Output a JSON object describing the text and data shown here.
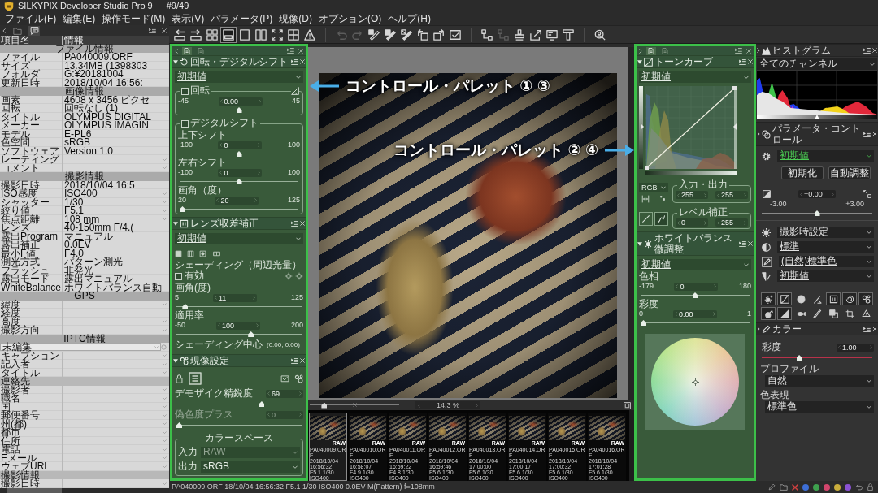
{
  "window": {
    "title": "SILKYPIX Developer Studio Pro 9",
    "counter": "#9/49"
  },
  "menu": [
    "ファイル(F)",
    "編集(E)",
    "操作モード(M)",
    "表示(V)",
    "パラメータ(P)",
    "現像(D)",
    "オプション(O)",
    "ヘルプ(H)"
  ],
  "toolbar": [
    [
      {
        "selected": false,
        "disabled": false
      },
      {
        "selected": false,
        "disabled": false
      },
      {
        "selected": false,
        "disabled": false
      },
      {
        "selected": true,
        "disabled": false
      },
      {
        "selected": false,
        "disabled": false
      },
      {
        "selected": false,
        "disabled": false
      },
      {
        "selected": false,
        "disabled": false
      },
      {
        "selected": false,
        "disabled": false
      },
      {
        "selected": false,
        "disabled": false
      }
    ],
    [
      {
        "selected": false,
        "disabled": true
      },
      {
        "selected": false,
        "disabled": true
      },
      {
        "selected": false,
        "disabled": false
      },
      {
        "selected": false,
        "disabled": false
      },
      {
        "selected": false,
        "disabled": false
      },
      {
        "selected": false,
        "disabled": false
      },
      {
        "selected": false,
        "disabled": false
      },
      {
        "selected": false,
        "disabled": false
      }
    ],
    [
      {
        "selected": false,
        "disabled": false
      },
      {
        "selected": false,
        "disabled": true
      },
      {
        "selected": false,
        "disabled": false
      },
      {
        "selected": false,
        "disabled": false
      },
      {
        "selected": false,
        "disabled": false
      },
      {
        "selected": false,
        "disabled": false
      }
    ],
    [
      {
        "selected": false,
        "disabled": false
      }
    ]
  ],
  "info_panel": {
    "tabs": [
      {
        "selected": false
      },
      {
        "selected": true
      }
    ],
    "columns": [
      "項目名",
      "情報"
    ],
    "rows": [
      {
        "kind": "section",
        "label": "ファイル情報"
      },
      {
        "kind": "field",
        "label": "ファイル",
        "value": "PA040009.ORF",
        "editable": false
      },
      {
        "kind": "field",
        "label": "サイズ",
        "value": "13.34MB (1398303",
        "editable": false
      },
      {
        "kind": "field",
        "label": "フォルダ",
        "value": "G:¥20181004",
        "editable": false
      },
      {
        "kind": "field",
        "label": "更新日時",
        "value": "2018/10/04 16:56:",
        "editable": false
      },
      {
        "kind": "section",
        "label": "画像情報"
      },
      {
        "kind": "field",
        "label": "画素",
        "value": "4608 x 3456 ピクセ",
        "editable": false
      },
      {
        "kind": "field",
        "label": "回転",
        "value": "回転なし (1)",
        "editable": false
      },
      {
        "kind": "field",
        "label": "タイトル",
        "value": "OLYMPUS DIGITAL",
        "editable": false
      },
      {
        "kind": "field",
        "label": "メーカー",
        "value": "OLYMPUS IMAGIN",
        "editable": false
      },
      {
        "kind": "field",
        "label": "モデル",
        "value": "E-PL6",
        "editable": false
      },
      {
        "kind": "field",
        "label": "色空間",
        "value": "sRGB",
        "editable": false
      },
      {
        "kind": "field",
        "label": "ソフトウェア",
        "value": "Version 1.0",
        "editable": false
      },
      {
        "kind": "field",
        "label": "レーティング",
        "editable": true
      },
      {
        "kind": "field",
        "label": "コメント",
        "editable": true
      },
      {
        "kind": "section",
        "label": "撮影情報"
      },
      {
        "kind": "field",
        "label": "撮影日時",
        "value": "2018/10/04 16:5",
        "editable": false
      },
      {
        "kind": "field",
        "label": "ISO感度",
        "value": "ISO400",
        "editable": true
      },
      {
        "kind": "field",
        "label": "シャッター",
        "value": "1/30",
        "editable": true
      },
      {
        "kind": "field",
        "label": "絞り値",
        "value": "F5.1",
        "editable": true
      },
      {
        "kind": "field",
        "label": "焦点距離",
        "value": "108 mm",
        "editable": true
      },
      {
        "kind": "field",
        "label": "レンズ",
        "value": "40-150mm F/4.(",
        "editable": false
      },
      {
        "kind": "field",
        "label": "露出Program",
        "value": "マニュアル",
        "editable": false
      },
      {
        "kind": "field",
        "label": "露出補正",
        "value": "0.0EV",
        "editable": false
      },
      {
        "kind": "field",
        "label": "最小F値",
        "value": "F4.0",
        "editable": false
      },
      {
        "kind": "field",
        "label": "測光方式",
        "value": "パターン測光",
        "editable": false
      },
      {
        "kind": "field",
        "label": "フラッシュ",
        "value": "非発光",
        "editable": false
      },
      {
        "kind": "field",
        "label": "露出モード",
        "value": "露出マニュアル",
        "editable": false
      },
      {
        "kind": "field",
        "label": "WhiteBalance",
        "value": "ホワイトバランス自動",
        "editable": false
      },
      {
        "kind": "section",
        "label": "GPS"
      },
      {
        "kind": "field",
        "label": "緯度",
        "editable": true
      },
      {
        "kind": "field",
        "label": "経度",
        "editable": false
      },
      {
        "kind": "field",
        "label": "高度",
        "editable": true
      },
      {
        "kind": "field",
        "label": "撮影方向",
        "editable": true
      },
      {
        "kind": "section",
        "label": "IPTC情報"
      },
      {
        "kind": "select",
        "label": "未編集"
      },
      {
        "kind": "field",
        "label": "キャプション",
        "editable": true
      },
      {
        "kind": "field",
        "label": "記入者",
        "editable": true
      },
      {
        "kind": "field",
        "label": "タイトル",
        "editable": true
      },
      {
        "kind": "subsection",
        "label": "連絡先"
      },
      {
        "kind": "field",
        "label": "撮影者",
        "editable": true
      },
      {
        "kind": "field",
        "label": "職名",
        "editable": true
      },
      {
        "kind": "field",
        "label": "国",
        "editable": true
      },
      {
        "kind": "field",
        "label": "郵便番号",
        "editable": true
      },
      {
        "kind": "field",
        "label": "州(都)",
        "editable": true
      },
      {
        "kind": "field",
        "label": "都市",
        "editable": true
      },
      {
        "kind": "field",
        "label": "住所",
        "editable": true
      },
      {
        "kind": "field",
        "label": "電話",
        "editable": true
      },
      {
        "kind": "field",
        "label": "Eメール",
        "editable": true
      },
      {
        "kind": "field",
        "label": "ウェブURL",
        "editable": true
      },
      {
        "kind": "subsection",
        "label": "撮影情報"
      },
      {
        "kind": "field",
        "label": "撮影日時",
        "editable": true
      }
    ]
  },
  "left_palette": {
    "tabs": [
      {
        "selected": true
      },
      {
        "selected": false
      }
    ],
    "rotation": {
      "title": "回転・デジタルシフト",
      "preset": "初期値",
      "rotate": {
        "label": "回転",
        "checked": false,
        "min": "-45",
        "value": "0.00",
        "max": "45",
        "level": 0.5
      },
      "shift": {
        "label": "デジタルシフト",
        "checked": false,
        "sliders": [
          {
            "label": "上下シフト",
            "min": "-100",
            "value": "0",
            "max": "100",
            "level": 0.5
          },
          {
            "label": "左右シフト",
            "min": "-100",
            "value": "0",
            "max": "100",
            "level": 0.5
          },
          {
            "label": "画角（度）",
            "min": "20",
            "value": "20",
            "max": "125",
            "level": 0
          }
        ]
      }
    },
    "lens": {
      "title": "レンズ収差補正",
      "preset": "初期値",
      "shading": {
        "title": "シェーディング（周辺光量）",
        "enable": {
          "label": "有効",
          "checked": false
        },
        "sliders": [
          {
            "label": "画角(度)",
            "min": "5",
            "value": "11",
            "max": "125",
            "level": 0.05
          },
          {
            "label": "適用率",
            "min": "-50",
            "value": "100",
            "max": "200",
            "level": 0.6
          }
        ],
        "center": {
          "label": "シェーディング中心",
          "value": "(0.00, 0.00)"
        }
      }
    },
    "develop": {
      "title": "現像設定",
      "sliders": [
        {
          "label": "デモザイク精鋭度",
          "value": "69",
          "level": 0.69,
          "disabled": false
        },
        {
          "label": "偽色度プラス",
          "value": "0",
          "level": 0,
          "disabled": true
        }
      ],
      "colorspace": {
        "title": "カラースペース",
        "fields": [
          {
            "label": "入力",
            "value": "RAW",
            "disabled": true
          },
          {
            "label": "出力",
            "value": "sRGB",
            "disabled": false
          }
        ]
      }
    }
  },
  "viewer": {
    "callouts": [
      {
        "text": "コントロール・パレット ① ③",
        "kind": "left"
      },
      {
        "text": "コントロール・パレット ② ④",
        "kind": "right"
      }
    ],
    "zoom": {
      "value": "14.3 %",
      "level": 0.14
    }
  },
  "filmstrip": [
    {
      "file": "PA040009.ORF",
      "date": "2018/10/04 16:56:32",
      "exposure": "F5.1 1/30 ISO400",
      "badge": "RAW",
      "selected": true
    },
    {
      "file": "PA040010.ORF",
      "date": "2018/10/04 16:58:07",
      "exposure": "F4.9 1/30 ISO400",
      "badge": "RAW",
      "selected": false
    },
    {
      "file": "PA040011.ORF",
      "date": "2018/10/04 16:59:22",
      "exposure": "F4.8 1/30 ISO400",
      "badge": "RAW",
      "selected": false
    },
    {
      "file": "PA040012.ORF",
      "date": "2018/10/04 16:59:46",
      "exposure": "F5.6 1/30 ISO400",
      "badge": "RAW",
      "selected": false
    },
    {
      "file": "PA040013.ORF",
      "date": "2018/10/04 17:00:00",
      "exposure": "F5.6 1/30 ISO400",
      "badge": "RAW",
      "selected": false
    },
    {
      "file": "PA040014.ORF",
      "date": "2018/10/04 17:00:17",
      "exposure": "F5.6 1/30 ISO400",
      "badge": "RAW",
      "selected": false
    },
    {
      "file": "PA040015.ORF",
      "date": "2018/10/04 17:00:32",
      "exposure": "F5.6 1/30 ISO400",
      "badge": "RAW",
      "selected": false
    },
    {
      "file": "PA040016.ORF",
      "date": "2018/10/04 17:01:28",
      "exposure": "F5.6 1/30 ISO400",
      "badge": "RAW",
      "selected": false
    }
  ],
  "right_palette": {
    "tabs": [
      {
        "selected": true
      },
      {
        "selected": false
      }
    ],
    "tone_curve": {
      "title": "トーンカーブ",
      "preset": "初期値",
      "channel": "RGB",
      "io": {
        "title": "入力・出力",
        "values": [
          "255",
          "255"
        ]
      },
      "levels": {
        "title": "レベル補正",
        "values": [
          "0",
          "255"
        ]
      },
      "modes": [
        {
          "selected": false
        },
        {
          "selected": true
        }
      ]
    },
    "white_balance": {
      "title": "ホワイトバランス微調整",
      "preset": "初期値",
      "sliders": [
        {
          "label": "色相",
          "min": "-179",
          "value": "0",
          "max": "180",
          "level": 0.5
        },
        {
          "label": "彩度",
          "min": "0",
          "value": "0.00",
          "max": "1",
          "level": 0
        }
      ]
    }
  },
  "right_panel": {
    "histogram": {
      "title": "ヒストグラム",
      "channel": "全てのチャンネル"
    },
    "parameter_control": {
      "title": "パラメータ・コントロール",
      "preset": "初期値",
      "buttons": [
        "初期化",
        "自動調整"
      ],
      "exposure": {
        "value": "+0.00",
        "min": "-3.00",
        "max": "+3.00",
        "level": 0.5
      },
      "selects": [
        "撮影時設定",
        "標準",
        "(自然)標準色",
        "初期値"
      ],
      "tools": [
        {
          "selected": true
        },
        {
          "selected": true
        },
        {
          "selected": false
        },
        {
          "selected": false
        },
        {
          "selected": true
        },
        {
          "selected": true
        },
        {
          "selected": true
        },
        {
          "selected": true
        },
        {
          "selected": true
        },
        {
          "selected": false
        },
        {
          "selected": false
        },
        {
          "selected": false
        },
        {
          "selected": false
        },
        {
          "selected": false
        }
      ]
    },
    "color": {
      "title": "カラー",
      "saturation": {
        "label": "彩度",
        "value": "1.00",
        "level": 0.33
      },
      "fields": [
        {
          "label": "プロファイル",
          "value": "自然"
        },
        {
          "label": "色表現",
          "value": "標準色"
        }
      ]
    }
  },
  "status_bar": {
    "text": "PA040009.ORF 18/10/04 16:56:32 F5.1 1/30 ISO400 0.0EV M(Pattern) f=108mm",
    "tags": [
      {
        "color": "#3d6ed6"
      },
      {
        "color": "#3ea04e"
      },
      {
        "color": "#d2456c"
      },
      {
        "color": "#c9ad3c"
      },
      {
        "color": "#8b52d4"
      }
    ]
  }
}
